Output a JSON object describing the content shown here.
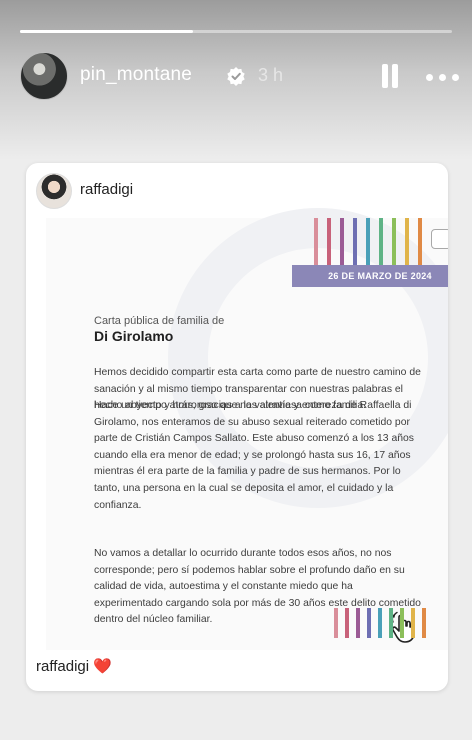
{
  "story": {
    "progress_fraction": 0.4,
    "username": "pin_montane",
    "time_ago": "3 h"
  },
  "icons": {
    "verified": "verified-badge-icon",
    "pause": "pause-icon",
    "more": "more-options-icon",
    "hand": "hand-pointer-icon",
    "heart": "heart-icon"
  },
  "post": {
    "username": "raffadigi",
    "caption_user": "raffadigi",
    "caption_heart": "❤️"
  },
  "letter": {
    "date": "26 DE MARZO DE 2024",
    "subtitle": "Carta pública de familia de",
    "family_name": "Di Girolamo",
    "paragraph_1": "Hemos decidido compartir esta carta como parte de nuestro camino de sanación y al mismo tiempo transparentar con nuestras palabras el hecho abyecto y horroroso que nos atraviesa como familia.",
    "paragraph_2": "Hace un tiempo atrás, gracias a la valentía y entereza de Raffaella di Girolamo, nos enteramos de su abuso sexual reiterado cometido por parte de Cristián Campos Sallato. Este abuso comenzó a los 13 años cuando ella era menor de edad; y se prolongó hasta sus 16, 17 años mientras él era parte de la familia y padre de sus hermanos. Por lo tanto, una persona en la cual se deposita el amor, el cuidado y la confianza.",
    "paragraph_3": "No vamos a detallar lo ocurrido durante todos esos años, no nos corresponde; pero sí podemos hablar sobre el profundo daño en su calidad de vida, autoestima y el constante miedo que ha experimentado cargando sola por más de 30 años este delito cometido dentro del núcleo familiar."
  },
  "colors": {
    "stripes": [
      "#d98e9a",
      "#c8627a",
      "#9b5b95",
      "#6e6fb3",
      "#4aa0b8",
      "#5fb386",
      "#8cbf5a",
      "#e0b44a",
      "#e08a45"
    ],
    "date_band": "#8b87b7"
  }
}
